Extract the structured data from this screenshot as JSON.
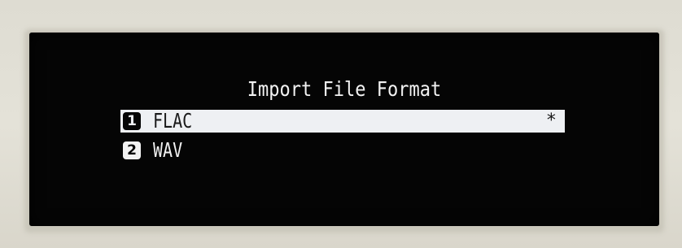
{
  "screen": {
    "title": "Import File Format",
    "items": [
      {
        "number": "1",
        "label": "FLAC",
        "selected": true,
        "marker": "*"
      },
      {
        "number": "2",
        "label": "WAV",
        "selected": false,
        "marker": ""
      }
    ]
  }
}
